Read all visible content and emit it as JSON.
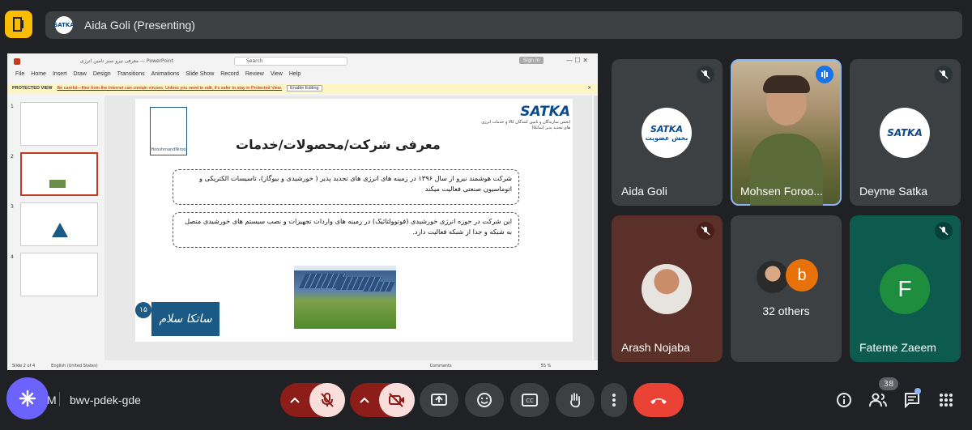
{
  "presenting": {
    "avatar_text": "SATKA",
    "text": "Aida Goli (Presenting)"
  },
  "slide_window": {
    "title": "معرفی نیرو سبز تامین انرژی — PowerPoint",
    "search": "Search",
    "sign_in": "Sign in",
    "menu": [
      "File",
      "Home",
      "Insert",
      "Draw",
      "Design",
      "Transitions",
      "Animations",
      "Slide Show",
      "Record",
      "Review",
      "View",
      "Help"
    ],
    "protected_label": "PROTECTED VIEW",
    "protected_msg": "Be careful—files from the Internet can contain viruses. Unless you need to edit, it's safer to stay in Protected View.",
    "enable_editing": "Enable Editing",
    "thumb_numbers": [
      "1",
      "2",
      "3",
      "4"
    ],
    "status_left": "Slide 2 of 4",
    "status_lang": "English (United States)",
    "status_comments": "Comments",
    "zoom": "55 %",
    "slide": {
      "title": "معرفی شرکت/محصولات/خدمات",
      "para1": "شرکت هوشمند نیرو از سال ۱۳۹۶ در زمینه های انرژی های تجدید پذیر ( خورشیدی و بیوگاز)، تاسیسات الکتریکی و اتوماسیون صنعتی فعالیت میکند",
      "para2": "این شرکت در حوزه انرژی خورشیدی (فوتوولتائیک) در زمینه های واردات تجهیزات و نصب سیستم های خورشیدی متصل به شبکه و جدا از شبکه فعالیت دارد.",
      "logo_left": "HooshmandNiroo",
      "logo_right": "SATKA",
      "logo_right_sub": "انجمن سازندگان و تامین کنندگان کالا و خدمات انرژی های تجدید پذیر (ساتکا)",
      "banner": "ساتکا سلام",
      "badge": "۱۵"
    }
  },
  "participants": [
    {
      "name": "Aida Goli",
      "logo": "SATKA",
      "logo_sub": "بخش عضویت"
    },
    {
      "name": "Mohsen Foroo...",
      "speaking": true
    },
    {
      "name": "Deyme Satka",
      "logo": "SATKA"
    },
    {
      "name": "Arash Nojaba"
    },
    {
      "name": "32 others",
      "avatar_letter": "b"
    },
    {
      "name": "Fateme Zaeem",
      "avatar_letter": "F"
    }
  ],
  "colors": {
    "bg": "#202124",
    "tile_bg": "#3c4043",
    "accent_yellow": "#fbbc04",
    "end_call": "#ea4335",
    "fateme_green": "#1e8e3e",
    "other_orange": "#e8710a"
  },
  "bottom": {
    "time": "M",
    "meeting_code": "bwv-pdek-gde",
    "people_count": "38"
  }
}
